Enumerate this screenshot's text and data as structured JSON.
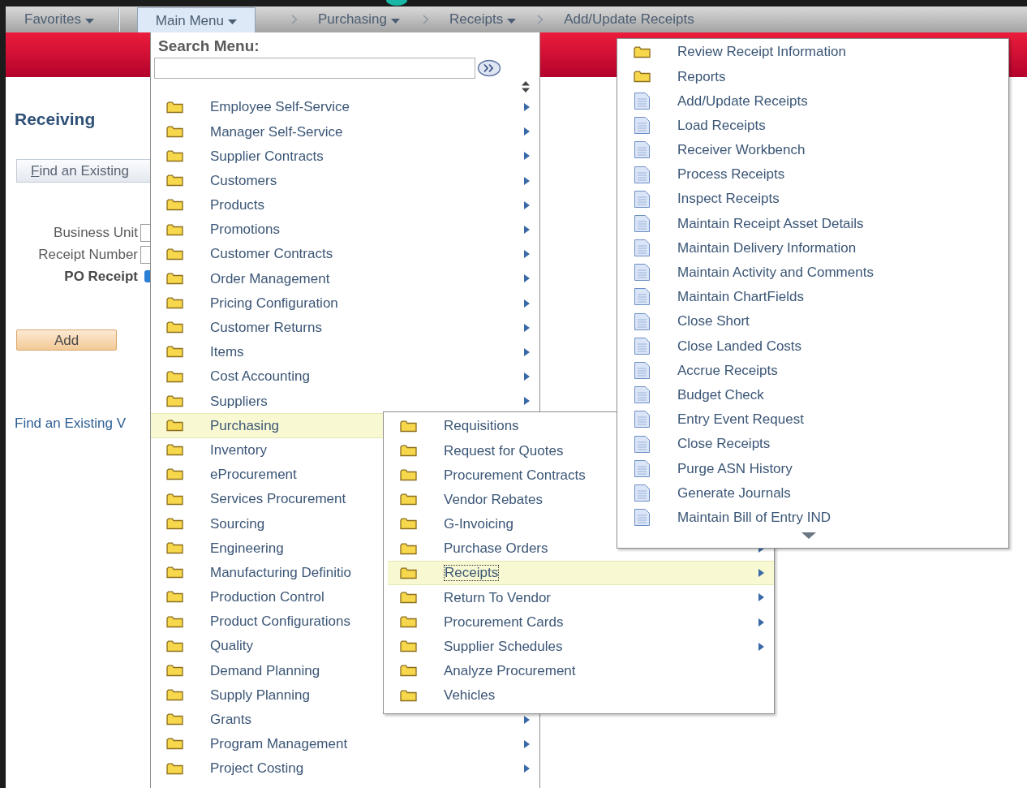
{
  "nav": {
    "favorites": {
      "label": "Favorites",
      "dropdown": true
    },
    "main_menu": {
      "label": "Main Menu",
      "dropdown": true,
      "selected": true
    },
    "breadcrumbs": [
      {
        "label": "Purchasing",
        "dropdown": true
      },
      {
        "label": "Receipts",
        "dropdown": true
      },
      {
        "label": "Add/Update Receipts",
        "dropdown": false
      }
    ]
  },
  "page": {
    "title": "Receiving",
    "find_button": "Find an Existing",
    "fields": [
      {
        "label": "Business Unit",
        "kind": "input"
      },
      {
        "label": "Receipt Number",
        "kind": "input"
      },
      {
        "label": "PO Receipt",
        "kind": "checkbox",
        "checked": true
      }
    ],
    "add_button": "Add",
    "link": "Find an Existing V"
  },
  "main_menu": {
    "search_label": "Search Menu:",
    "items": [
      {
        "label": "Employee Self-Service",
        "kind": "folder",
        "selected": false
      },
      {
        "label": "Manager Self-Service",
        "kind": "folder",
        "selected": false
      },
      {
        "label": "Supplier Contracts",
        "kind": "folder",
        "selected": false
      },
      {
        "label": "Customers",
        "kind": "folder",
        "selected": false
      },
      {
        "label": "Products",
        "kind": "folder",
        "selected": false
      },
      {
        "label": "Promotions",
        "kind": "folder",
        "selected": false
      },
      {
        "label": "Customer Contracts",
        "kind": "folder",
        "selected": false
      },
      {
        "label": "Order Management",
        "kind": "folder",
        "selected": false
      },
      {
        "label": "Pricing Configuration",
        "kind": "folder",
        "selected": false
      },
      {
        "label": "Customer Returns",
        "kind": "folder",
        "selected": false
      },
      {
        "label": "Items",
        "kind": "folder",
        "selected": false
      },
      {
        "label": "Cost Accounting",
        "kind": "folder",
        "selected": false
      },
      {
        "label": "Suppliers",
        "kind": "folder",
        "selected": false
      },
      {
        "label": "Purchasing",
        "kind": "folder",
        "selected": true
      },
      {
        "label": "Inventory",
        "kind": "folder",
        "selected": false
      },
      {
        "label": "eProcurement",
        "kind": "folder",
        "selected": false
      },
      {
        "label": "Services Procurement",
        "kind": "folder",
        "selected": false
      },
      {
        "label": "Sourcing",
        "kind": "folder",
        "selected": false
      },
      {
        "label": "Engineering",
        "kind": "folder",
        "selected": false
      },
      {
        "label": "Manufacturing Definitio",
        "kind": "folder",
        "selected": false
      },
      {
        "label": "Production Control",
        "kind": "folder",
        "selected": false
      },
      {
        "label": "Product Configurations",
        "kind": "folder",
        "selected": false
      },
      {
        "label": "Quality",
        "kind": "folder",
        "selected": false
      },
      {
        "label": "Demand Planning",
        "kind": "folder",
        "selected": false
      },
      {
        "label": "Supply Planning",
        "kind": "folder",
        "selected": false
      },
      {
        "label": "Grants",
        "kind": "folder",
        "selected": false
      },
      {
        "label": "Program Management",
        "kind": "folder",
        "selected": false
      },
      {
        "label": "Project Costing",
        "kind": "folder",
        "selected": false
      }
    ]
  },
  "purchasing_menu": {
    "items": [
      {
        "label": "Requisitions",
        "kind": "folder",
        "selected": false
      },
      {
        "label": "Request for Quotes",
        "kind": "folder",
        "selected": false
      },
      {
        "label": "Procurement Contracts",
        "kind": "folder",
        "selected": false
      },
      {
        "label": "Vendor Rebates",
        "kind": "folder",
        "selected": false
      },
      {
        "label": "G-Invoicing",
        "kind": "folder",
        "selected": false
      },
      {
        "label": "Purchase Orders",
        "kind": "folder",
        "selected": false
      },
      {
        "label": "Receipts",
        "kind": "folder",
        "selected": true
      },
      {
        "label": "Return To Vendor",
        "kind": "folder",
        "selected": false
      },
      {
        "label": "Procurement Cards",
        "kind": "folder",
        "selected": false
      },
      {
        "label": "Supplier Schedules",
        "kind": "folder",
        "selected": false
      },
      {
        "label": "Analyze Procurement",
        "kind": "folder",
        "selected": false
      },
      {
        "label": "Vehicles",
        "kind": "folder",
        "selected": false
      }
    ]
  },
  "receipts_menu": {
    "items": [
      {
        "label": "Review Receipt Information",
        "kind": "folder",
        "selected": false
      },
      {
        "label": "Reports",
        "kind": "folder",
        "selected": false
      },
      {
        "label": "Add/Update Receipts",
        "kind": "page",
        "selected": false
      },
      {
        "label": "Load Receipts",
        "kind": "page",
        "selected": false
      },
      {
        "label": "Receiver Workbench",
        "kind": "page",
        "selected": false
      },
      {
        "label": "Process Receipts",
        "kind": "page",
        "selected": false
      },
      {
        "label": "Inspect Receipts",
        "kind": "page",
        "selected": false
      },
      {
        "label": "Maintain Receipt Asset Details",
        "kind": "page",
        "selected": false
      },
      {
        "label": "Maintain Delivery Information",
        "kind": "page",
        "selected": false
      },
      {
        "label": "Maintain Activity and Comments",
        "kind": "page",
        "selected": false
      },
      {
        "label": "Maintain ChartFields",
        "kind": "page",
        "selected": false
      },
      {
        "label": "Close Short",
        "kind": "page",
        "selected": false
      },
      {
        "label": "Close Landed Costs",
        "kind": "page",
        "selected": false
      },
      {
        "label": "Accrue Receipts",
        "kind": "page",
        "selected": false
      },
      {
        "label": "Budget Check",
        "kind": "page",
        "selected": false
      },
      {
        "label": "Entry Event Request",
        "kind": "page",
        "selected": false
      },
      {
        "label": "Close Receipts",
        "kind": "page",
        "selected": false
      },
      {
        "label": "Purge ASN History",
        "kind": "page",
        "selected": false
      },
      {
        "label": "Generate Journals",
        "kind": "page",
        "selected": false
      },
      {
        "label": "Maintain Bill of Entry IND",
        "kind": "page",
        "selected": false
      }
    ]
  }
}
